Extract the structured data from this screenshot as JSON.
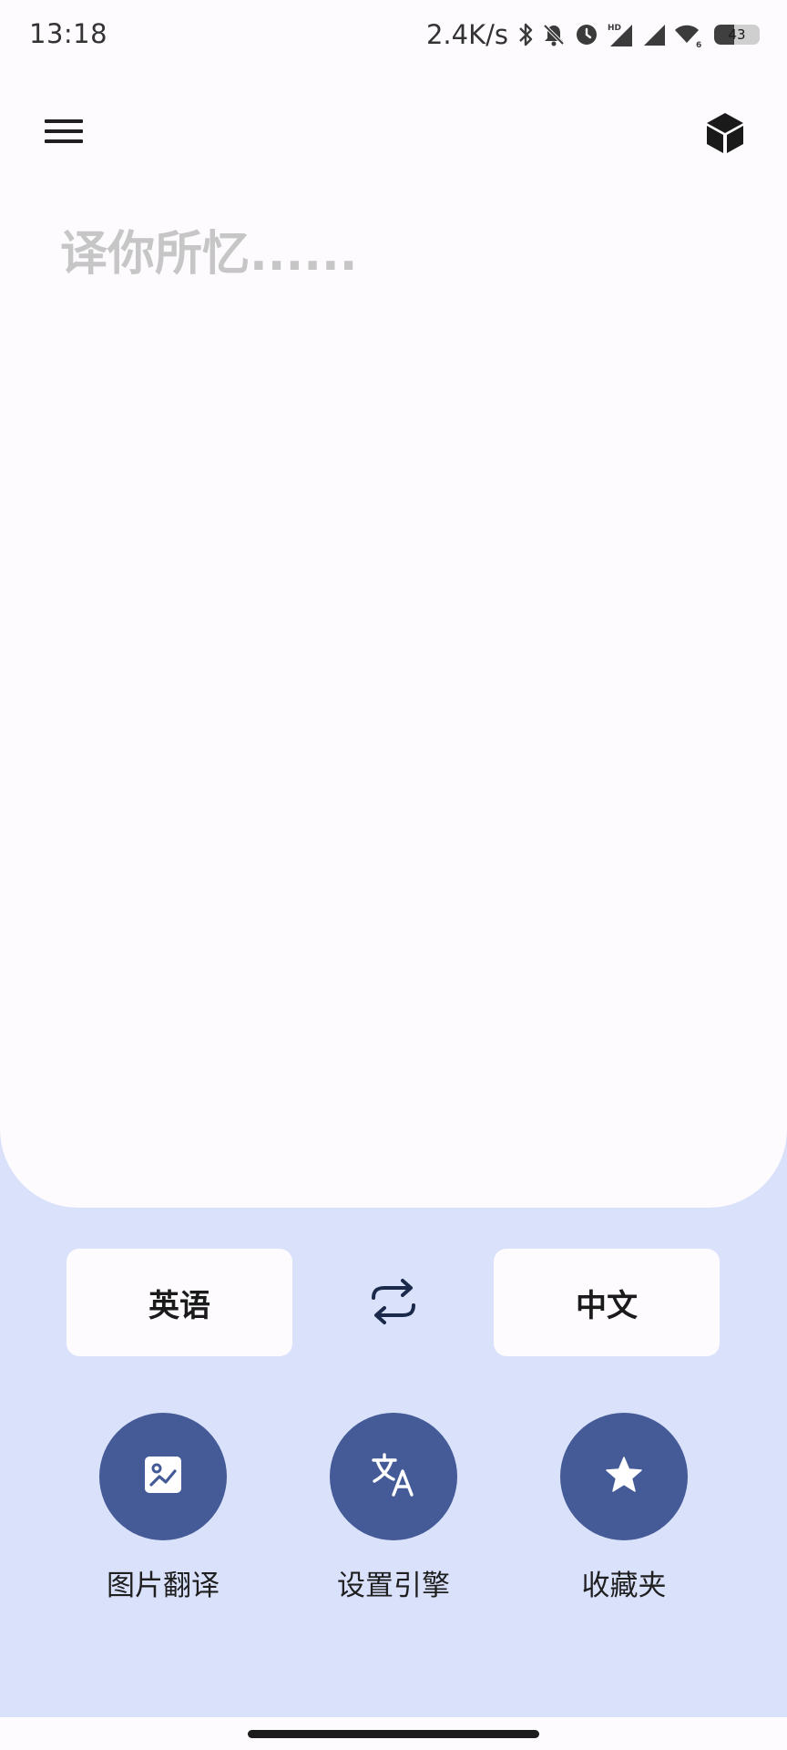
{
  "status_bar": {
    "time": "13:18",
    "net_speed": "2.4K/s",
    "battery_level": "43",
    "battery_fraction": 0.43,
    "icons": [
      "bluetooth-icon",
      "bell-off-icon",
      "alarm-icon",
      "hd-signal-icon",
      "signal-icon",
      "wifi-icon",
      "battery-icon"
    ]
  },
  "toolbar": {
    "menu_icon": "menu-icon",
    "cube_icon": "cube-icon"
  },
  "input": {
    "placeholder": "译你所忆......",
    "value": ""
  },
  "languages": {
    "source": "英语",
    "target": "中文",
    "swap_icon": "swap-icon"
  },
  "actions": [
    {
      "label": "图片翻译",
      "icon": "image-icon"
    },
    {
      "label": "设置引擎",
      "icon": "translate-icon"
    },
    {
      "label": "收藏夹",
      "icon": "star-icon"
    }
  ],
  "colors": {
    "background": "#dae1fb",
    "card": "#fdfbfe",
    "accent": "#455b98",
    "placeholder": "#c6c6c6"
  }
}
